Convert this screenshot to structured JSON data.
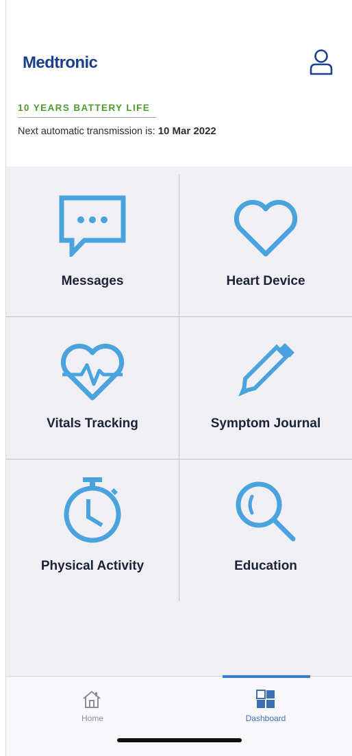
{
  "header": {
    "brand": "Medtronic",
    "battery_status": "10 YEARS BATTERY LIFE",
    "transmission_prefix": "Next automatic transmission is:",
    "transmission_date": "10 Mar 2022",
    "profile_icon": "user-icon"
  },
  "tiles": [
    {
      "label": "Messages",
      "icon": "chat-bubble-icon"
    },
    {
      "label": "Heart Device",
      "icon": "heart-icon"
    },
    {
      "label": "Vitals Tracking",
      "icon": "heart-pulse-icon"
    },
    {
      "label": "Symptom Journal",
      "icon": "pencil-icon"
    },
    {
      "label": "Physical Activity",
      "icon": "stopwatch-icon"
    },
    {
      "label": "Education",
      "icon": "magnifier-icon"
    }
  ],
  "tabbar": {
    "tabs": [
      {
        "label": "Home",
        "icon": "home-icon",
        "selected": false
      },
      {
        "label": "Dashboard",
        "icon": "dashboard-grid-icon",
        "selected": true
      }
    ]
  },
  "colors": {
    "brand": "#1a3f8c",
    "battery_ok": "#4a9b2c",
    "icon_blue": "#4aa3dc",
    "active_tab": "#3d6fb5",
    "inactive_tab": "#8a8c94",
    "grid_background": "#efeff4"
  }
}
